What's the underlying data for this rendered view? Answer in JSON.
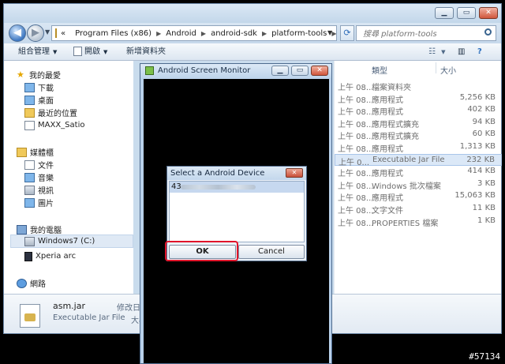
{
  "explorer": {
    "breadcrumb": [
      "Program Files (x86)",
      "Android",
      "android-sdk",
      "platform-tools"
    ],
    "breadcrumb_lead": "«",
    "search_placeholder": "搜尋 platform-tools",
    "toolbar": {
      "organize": "組合管理",
      "open": "開啟",
      "new_folder": "新增資料夾"
    },
    "nav": {
      "favorites": "我的最愛",
      "favorites_items": [
        "下載",
        "桌面",
        "最近的位置",
        "MAXX_Satio"
      ],
      "libraries": "媒體櫃",
      "libraries_items": [
        "文件",
        "音樂",
        "視訊",
        "圖片"
      ],
      "computer": "我的電腦",
      "computer_items": [
        "Windows7 (C:)",
        "Xperia arc"
      ],
      "network": "網路"
    },
    "columns": {
      "type": "類型",
      "size": "大小"
    },
    "files": [
      {
        "date": "上午 08...",
        "type": "檔案資料夾",
        "size": ""
      },
      {
        "date": "上午 08...",
        "type": "應用程式",
        "size": "5,256 KB"
      },
      {
        "date": "上午 08...",
        "type": "應用程式",
        "size": "402 KB"
      },
      {
        "date": "上午 08...",
        "type": "應用程式擴充",
        "size": "94 KB"
      },
      {
        "date": "上午 08...",
        "type": "應用程式擴充",
        "size": "60 KB"
      },
      {
        "date": "上午 08...",
        "type": "應用程式",
        "size": "1,313 KB"
      },
      {
        "date": "上午 0...",
        "type": "Executable Jar File",
        "size": "232 KB"
      },
      {
        "date": "上午 08...",
        "type": "應用程式",
        "size": "414 KB"
      },
      {
        "date": "上午 08...",
        "type": "Windows 批次檔案",
        "size": "3 KB"
      },
      {
        "date": "上午 08...",
        "type": "應用程式",
        "size": "15,063 KB"
      },
      {
        "date": "上午 08...",
        "type": "文字文件",
        "size": "11 KB"
      },
      {
        "date": "上午 08...",
        "type": "PROPERTIES 檔案",
        "size": "1 KB"
      }
    ],
    "details": {
      "filename": "asm.jar",
      "filetype": "Executable Jar File",
      "mod_label": "修改日",
      "size_label": "大小"
    }
  },
  "asm_window": {
    "title": "Android Screen Monitor"
  },
  "dialog": {
    "title": "Select a Android Device",
    "device_prefix": "43",
    "ok": "OK",
    "cancel": "Cancel"
  },
  "watermark": "#57134",
  "colors": {
    "highlight": "#e1142a",
    "screen": "#000000"
  }
}
